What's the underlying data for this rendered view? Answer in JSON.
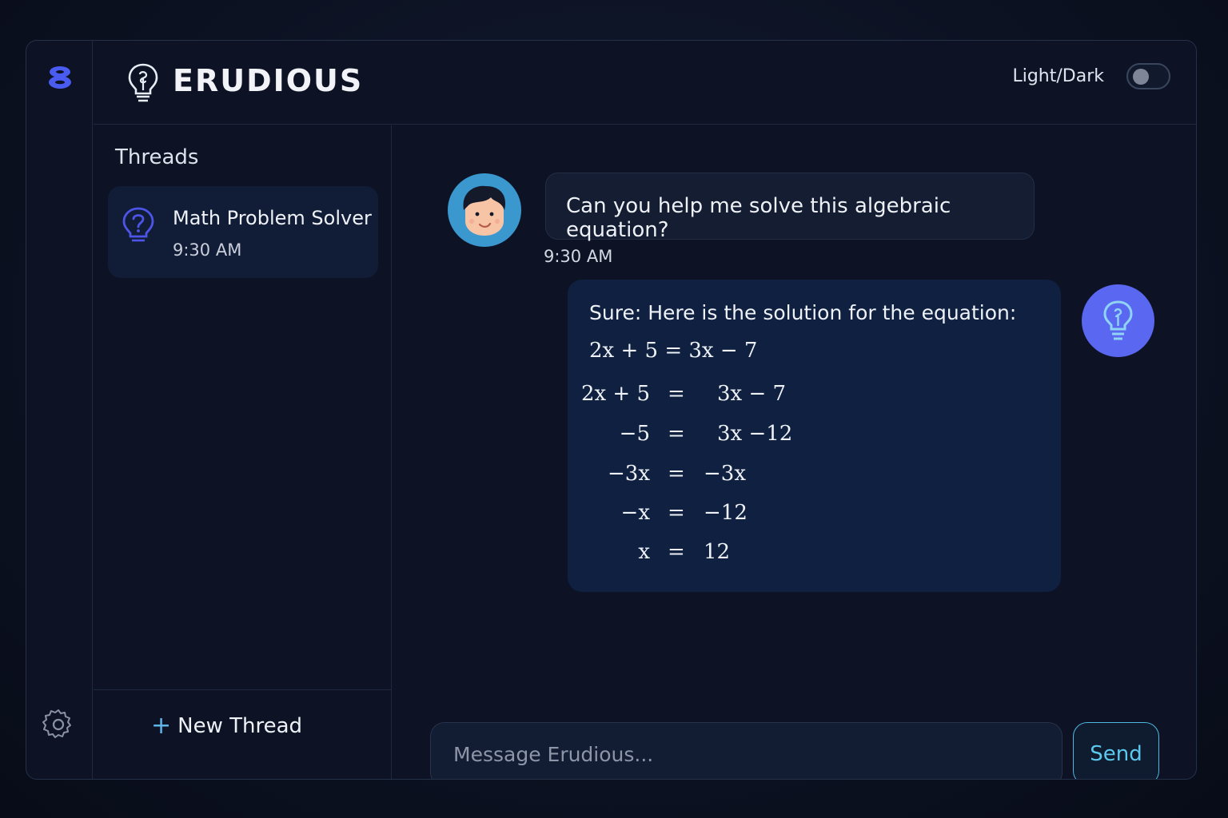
{
  "app": {
    "brand_name": "ERUDIOUS",
    "theme_toggle_label": "Light/Dark",
    "theme_dark": false,
    "accent_color": "#5a67f0",
    "send_color": "#5cc8ee"
  },
  "sidebar": {
    "title": "Threads",
    "threads": [
      {
        "name": "Math Problem Solver",
        "time": "9:30 AM",
        "icon": "question-bulb-icon"
      }
    ],
    "new_thread_label": "New Thread"
  },
  "chat": {
    "user_message": {
      "text": "Can you help me solve this algebraic equation?",
      "time": "9:30 AM"
    },
    "bot_message": {
      "intro": "Sure: Here is the solution for the equation:",
      "equation": "2x + 5 = 3x − 7",
      "steps": [
        {
          "left": "2x + 5",
          "sign": "=",
          "right": "3x − 7"
        },
        {
          "left": "−5",
          "sign": "=",
          "right": "3x −12"
        },
        {
          "left": "−3x",
          "sign": "=",
          "right": "−3x"
        },
        {
          "left": "−x",
          "sign": "=",
          "right": "−12"
        },
        {
          "left": "x",
          "sign": "=",
          "right": "12"
        }
      ]
    }
  },
  "composer": {
    "placeholder": "Message Erudious...",
    "value": "",
    "send_label": "Send"
  }
}
